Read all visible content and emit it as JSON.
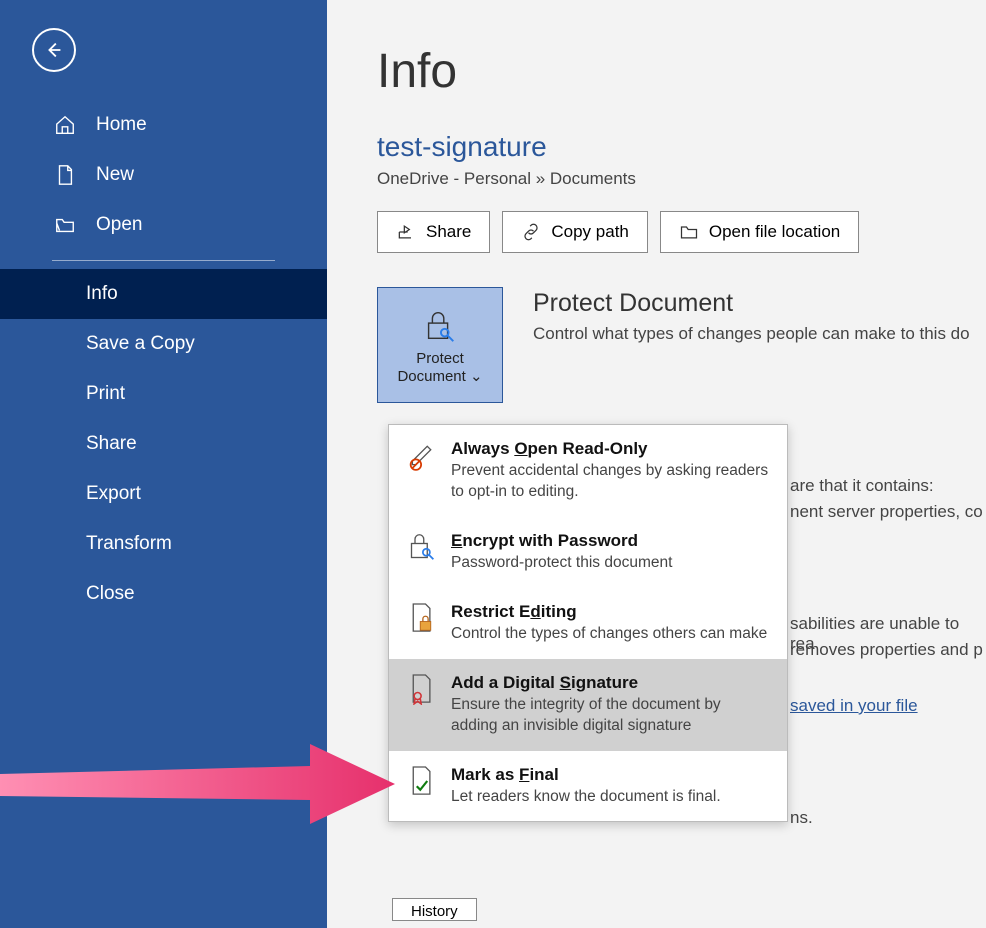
{
  "sidebar": {
    "items": [
      {
        "label": "Home"
      },
      {
        "label": "New"
      },
      {
        "label": "Open"
      },
      {
        "label": "Info"
      },
      {
        "label": "Save a Copy"
      },
      {
        "label": "Print"
      },
      {
        "label": "Share"
      },
      {
        "label": "Export"
      },
      {
        "label": "Transform"
      },
      {
        "label": "Close"
      }
    ]
  },
  "page": {
    "title": "Info",
    "doc_name": "test-signature",
    "location": "OneDrive - Personal » Documents"
  },
  "actions": {
    "share": "Share",
    "copy_path": "Copy path",
    "open_location": "Open file location"
  },
  "protect": {
    "btn_line1": "Protect",
    "btn_line2": "Document",
    "heading": "Protect Document",
    "desc": "Control what types of changes people can make to this do"
  },
  "dropdown": {
    "items": [
      {
        "title": "Always Open Read-Only",
        "desc": "Prevent accidental changes by asking readers to opt-in to editing."
      },
      {
        "title": "Encrypt with Password",
        "desc": "Password-protect this document"
      },
      {
        "title": "Restrict Editing",
        "desc": "Control the types of changes others can make"
      },
      {
        "title": "Add a Digital Signature",
        "desc": "Ensure the integrity of the document by adding an invisible digital signature"
      },
      {
        "title": "Mark as Final",
        "desc": "Let readers know the document is final."
      }
    ]
  },
  "bg": {
    "t1": "are that it contains:",
    "t2": "nent server properties, co",
    "t3": "sabilities are unable to rea",
    "t4": "removes properties and p",
    "t5": "saved in your file",
    "t6": "ns.",
    "history": "History"
  }
}
